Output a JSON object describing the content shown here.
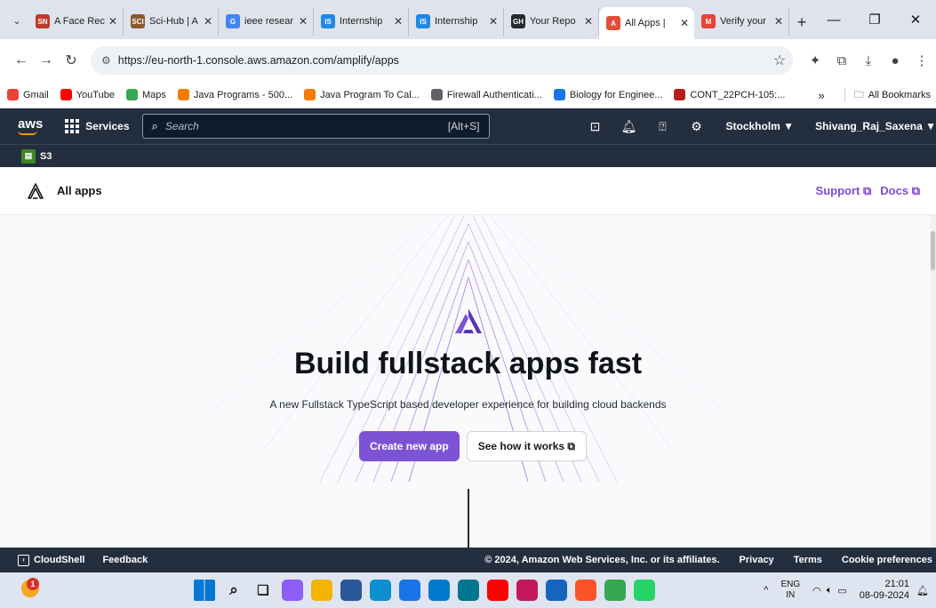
{
  "browser": {
    "tabs": [
      {
        "title": "A Face Rec",
        "favicon": "SN",
        "color": "#c0392b",
        "active": false
      },
      {
        "title": "Sci-Hub | A",
        "favicon": "SCI",
        "color": "#8b5a2b",
        "active": false
      },
      {
        "title": "ieee resear",
        "favicon": "G",
        "color": "#4285f4",
        "active": false
      },
      {
        "title": "Internship",
        "favicon": "IS",
        "color": "#1e88e5",
        "active": false
      },
      {
        "title": "Internship",
        "favicon": "IS",
        "color": "#1e88e5",
        "active": false
      },
      {
        "title": "Your Repo",
        "favicon": "GH",
        "color": "#24292f",
        "active": false
      },
      {
        "title": "All Apps |",
        "favicon": "A",
        "color": "#e04e39",
        "active": true
      },
      {
        "title": "Verify your",
        "favicon": "M",
        "color": "#ea4335",
        "active": false
      }
    ],
    "url": "https://eu-north-1.console.aws.amazon.com/amplify/apps",
    "bookmarks": [
      {
        "label": "Gmail",
        "color": "#ea4335"
      },
      {
        "label": "YouTube",
        "color": "#ff0000"
      },
      {
        "label": "Maps",
        "color": "#34a853"
      },
      {
        "label": "Java Programs - 500...",
        "color": "#f57c00"
      },
      {
        "label": "Java Program To Cal...",
        "color": "#f57c00"
      },
      {
        "label": "Firewall Authenticati...",
        "color": "#5f6368"
      },
      {
        "label": "Biology for Enginee...",
        "color": "#1a73e8"
      },
      {
        "label": "CONT_22PCH-105:...",
        "color": "#b71c1c"
      }
    ],
    "all_bookmarks_label": "All Bookmarks",
    "overflow_label": "»"
  },
  "aws": {
    "logo_text": "aws",
    "services_label": "Services",
    "search_placeholder": "Search",
    "search_shortcut": "[Alt+S]",
    "region": "Stockholm ▼",
    "user": "Shivang_Raj_Saxena ▼",
    "favorite_service": "S3"
  },
  "page": {
    "title": "All apps",
    "support_label": "Support",
    "docs_label": "Docs"
  },
  "hero": {
    "title": "Build fullstack apps fast",
    "subtitle": "A new Fullstack TypeScript based developer experience for building cloud backends",
    "primary_button": "Create new app",
    "secondary_button": "See how it works"
  },
  "footer": {
    "cloudshell": "CloudShell",
    "feedback": "Feedback",
    "copyright": "© 2024, Amazon Web Services, Inc. or its affiliates.",
    "privacy": "Privacy",
    "terms": "Terms",
    "cookies": "Cookie preferences"
  },
  "taskbar": {
    "weather_badge": "1",
    "lang_line1": "ENG",
    "lang_line2": "IN",
    "time": "21:01",
    "date": "08-09-2024",
    "apps": [
      {
        "name": "windows-start-icon",
        "color": "#0078d4"
      },
      {
        "name": "search-icon",
        "color": "#dfe5f0"
      },
      {
        "name": "task-view-icon",
        "color": "#dfe5f0"
      },
      {
        "name": "copilot-icon",
        "color": "#8e5cf7"
      },
      {
        "name": "file-explorer-icon",
        "color": "#f4b400"
      },
      {
        "name": "ms-store-icon",
        "color": "#2b579a"
      },
      {
        "name": "edge-icon",
        "color": "#0c8fcf"
      },
      {
        "name": "chatgpt-icon",
        "color": "#1a73e8"
      },
      {
        "name": "vscode-icon",
        "color": "#007acc"
      },
      {
        "name": "mysql-icon",
        "color": "#00758f"
      },
      {
        "name": "youtube-icon",
        "color": "#ff0000"
      },
      {
        "name": "intellij-icon",
        "color": "#c2185b"
      },
      {
        "name": "mail-icon",
        "color": "#1565c0"
      },
      {
        "name": "brave-icon",
        "color": "#fb542b"
      },
      {
        "name": "chrome-icon",
        "color": "#34a853"
      },
      {
        "name": "whatsapp-icon",
        "color": "#25d366"
      }
    ]
  },
  "colors": {
    "aws_nav": "#232f3e",
    "accent_purple": "#7d53d6",
    "link_purple": "#7d4bd6"
  }
}
